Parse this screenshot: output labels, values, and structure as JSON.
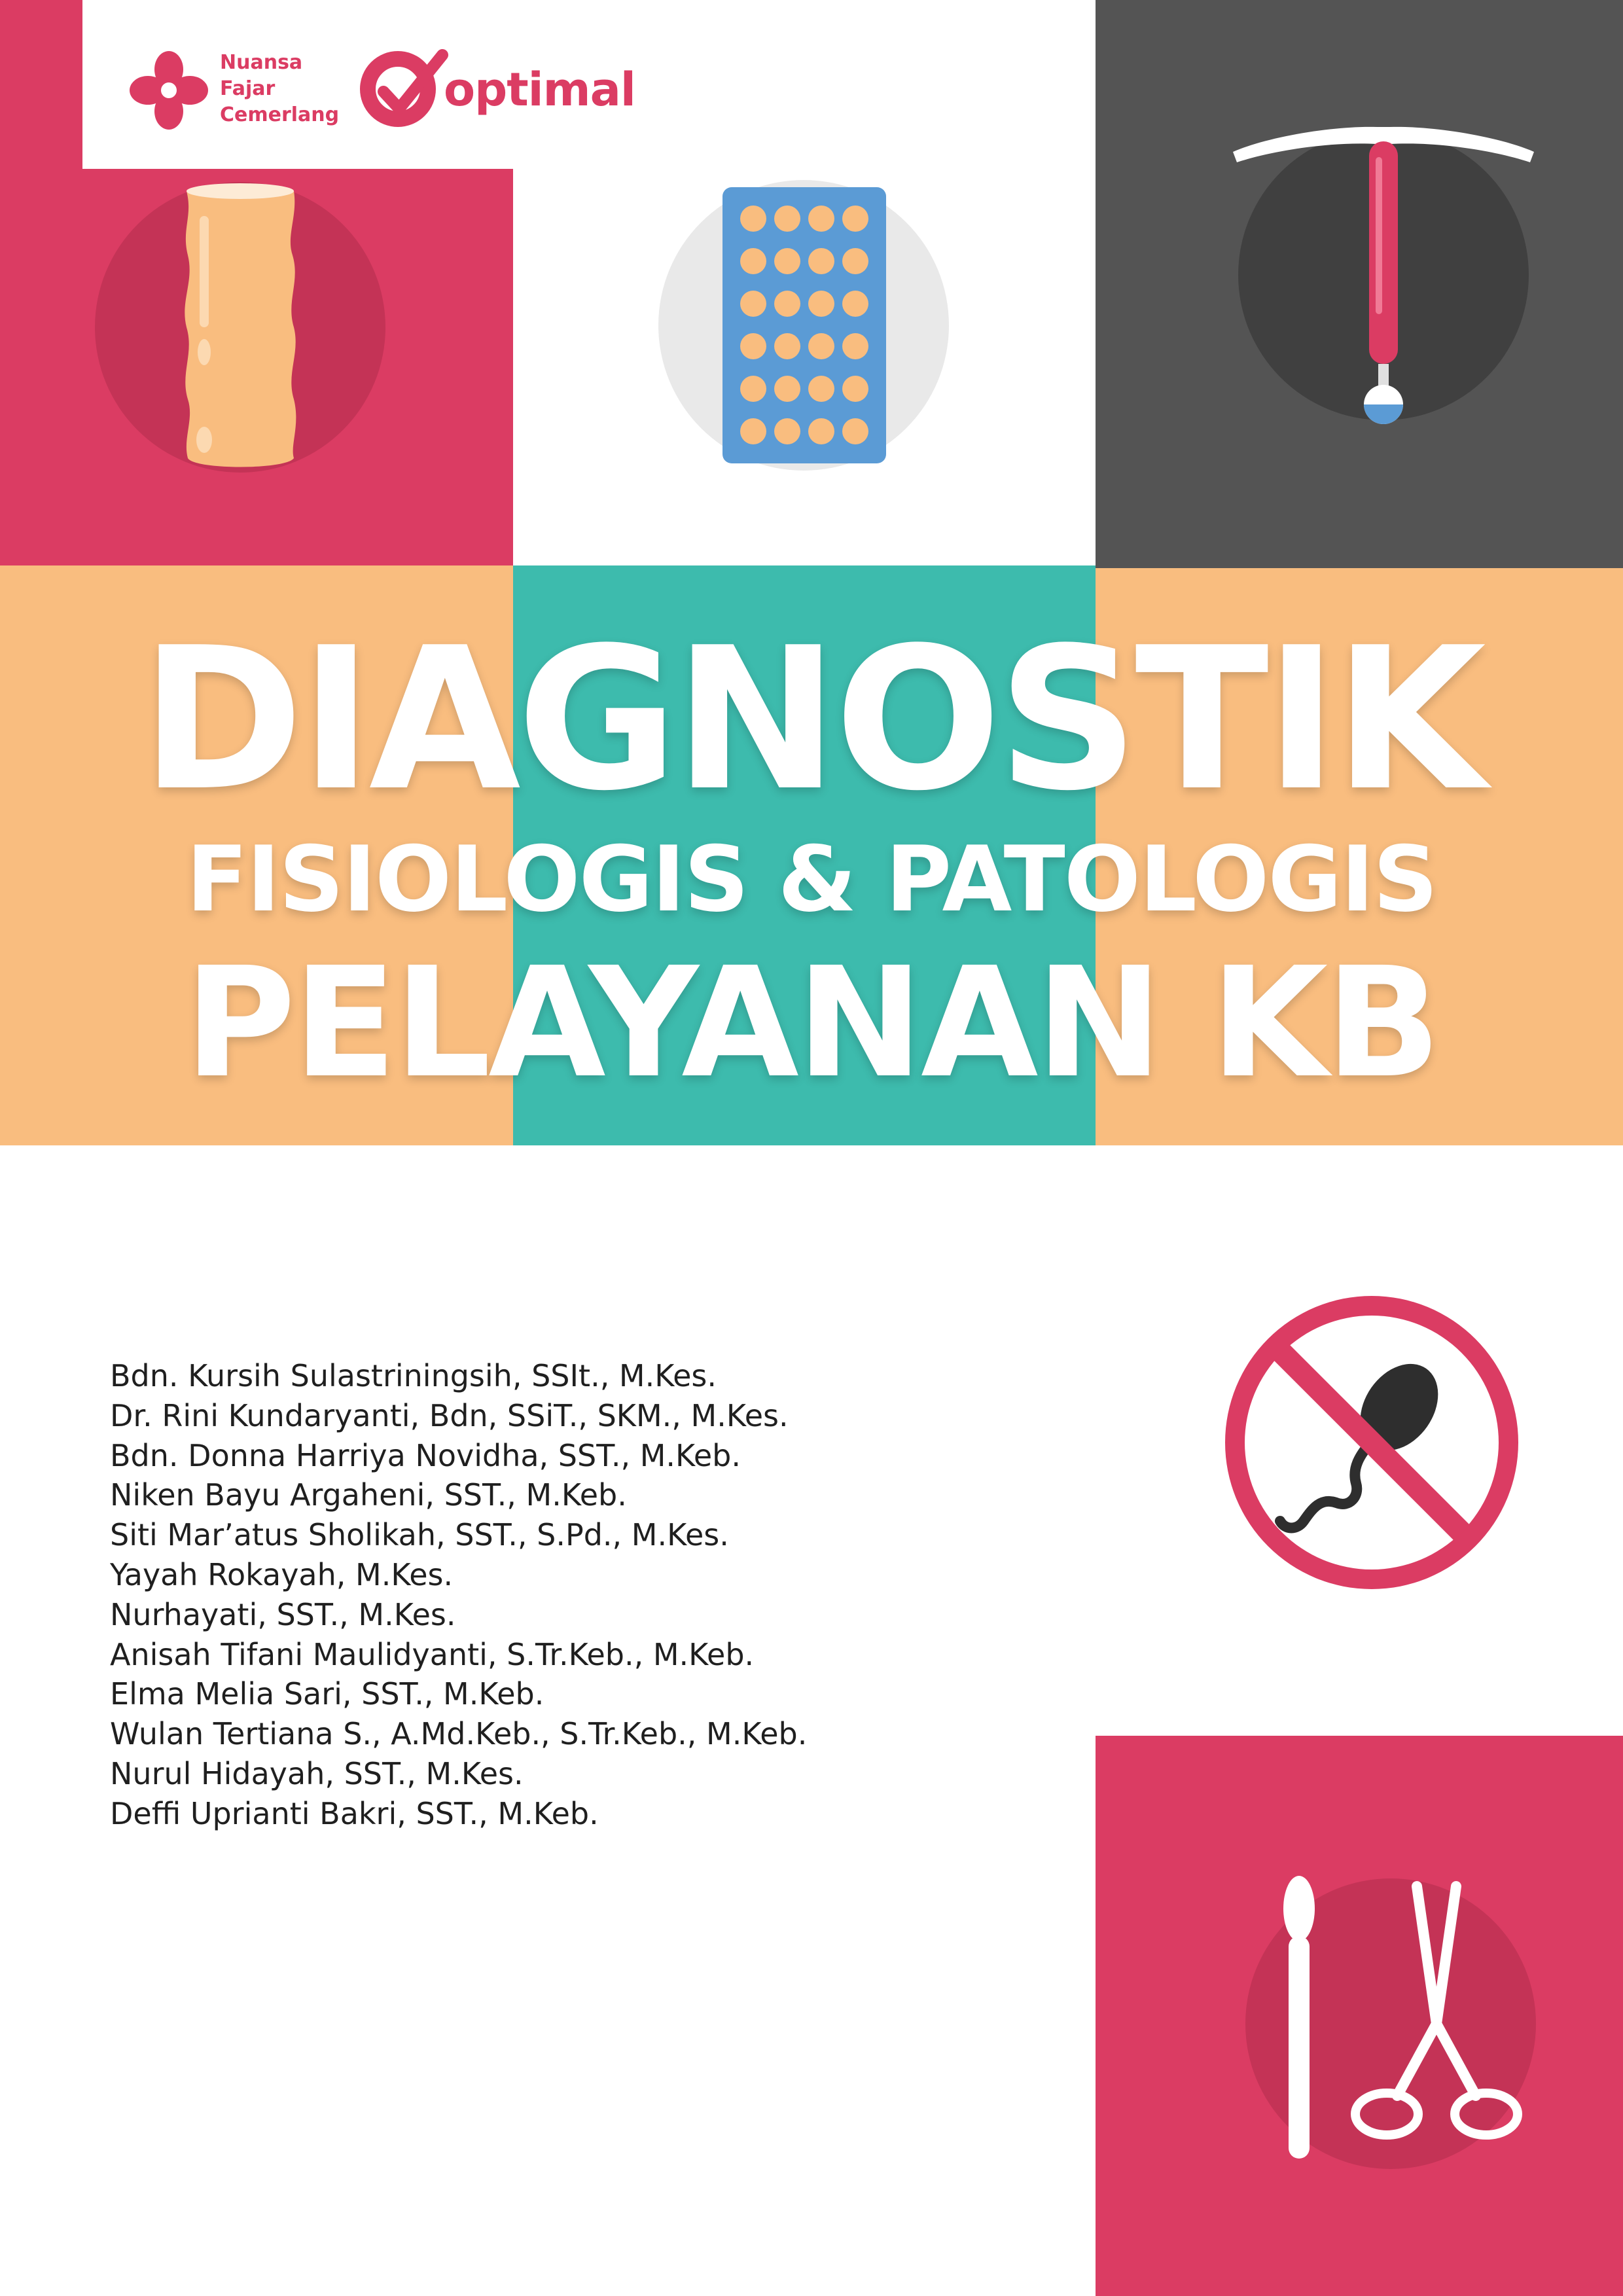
{
  "publisher": {
    "name_line1": "Nuansa",
    "name_line2": "Fajar",
    "name_line3": "Cemerlang",
    "imprint": "optimal"
  },
  "title": {
    "line1": "DIAGNOSTIK",
    "line2": "FISIOLOGIS & PATOLOGIS",
    "line3": "PELAYANAN KB"
  },
  "authors": [
    "Bdn. Kursih Sulastriningsih, SSIt., M.Kes.",
    "Dr. Rini Kundaryanti, Bdn, SSiT., SKM., M.Kes.",
    "Bdn. Donna Harriya Novidha, SST., M.Keb.",
    "Niken Bayu Argaheni, SST., M.Keb.",
    "Siti Mar’atus Sholikah, SST., S.Pd., M.Kes.",
    "Yayah Rokayah, M.Kes.",
    "Nurhayati, SST., M.Kes.",
    "Anisah Tifani Maulidyanti, S.Tr.Keb., M.Keb.",
    "Elma Melia Sari, SST., M.Keb.",
    "Wulan Tertiana S., A.Md.Keb., S.Tr.Keb., M.Keb.",
    "Nurul Hidayah, SST., M.Kes.",
    "Deffi Uprianti Bakri, SST., M.Keb."
  ],
  "illustrations": {
    "top_left": "contraceptive-implant-icon",
    "top_center": "pill-blister-icon",
    "top_right": "iud-icon",
    "right_middle": "no-sperm-icon",
    "bottom_right": "speculum-forceps-icon"
  },
  "colors": {
    "pink": "#DB3C63",
    "dark_gray": "#545454",
    "peach": "#F9BD7F",
    "teal": "#3DBBAD",
    "white": "#FFFFFF",
    "text": "#1F1F1F"
  }
}
